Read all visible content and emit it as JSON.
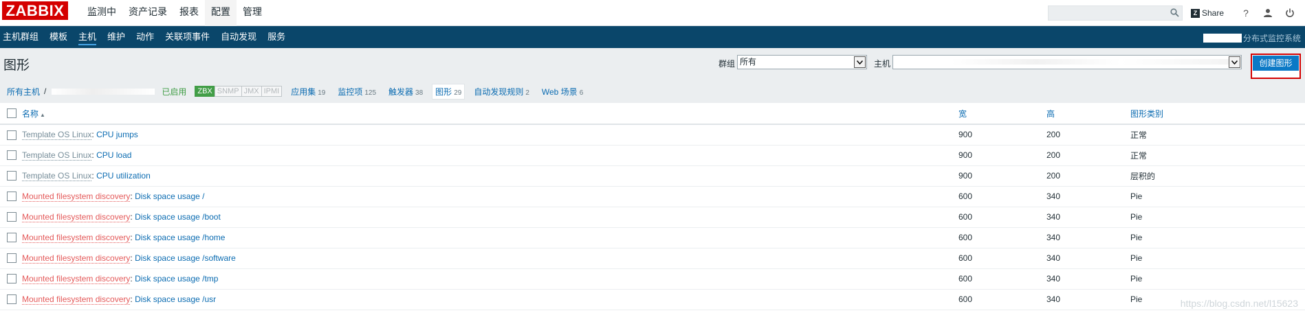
{
  "header": {
    "logo": "ZABBIX",
    "menu": [
      {
        "label": "监测中",
        "active": false
      },
      {
        "label": "资产记录",
        "active": false
      },
      {
        "label": "报表",
        "active": false
      },
      {
        "label": "配置",
        "active": true
      },
      {
        "label": "管理",
        "active": false
      }
    ],
    "search_value": "",
    "share_label": "Share",
    "share_logo_letter": "Z",
    "help_symbol": "?"
  },
  "subnav": {
    "items": [
      {
        "label": "主机群组",
        "active": false
      },
      {
        "label": "模板",
        "active": false
      },
      {
        "label": "主机",
        "active": true
      },
      {
        "label": "维护",
        "active": false
      },
      {
        "label": "动作",
        "active": false
      },
      {
        "label": "关联项事件",
        "active": false
      },
      {
        "label": "自动发现",
        "active": false
      },
      {
        "label": "服务",
        "active": false
      }
    ],
    "system_name": "分布式监控系统"
  },
  "page": {
    "title": "图形",
    "group_label": "群组",
    "group_value": "所有",
    "host_label": "主机",
    "host_value": "",
    "create_button": "创建图形"
  },
  "host_nav": {
    "all_hosts": "所有主机",
    "separator": "/",
    "status": "已启用",
    "availability": [
      {
        "label": "ZBX",
        "on": true
      },
      {
        "label": "SNMP",
        "on": false
      },
      {
        "label": "JMX",
        "on": false
      },
      {
        "label": "IPMI",
        "on": false
      }
    ],
    "links": [
      {
        "label": "应用集",
        "count": "19",
        "current": false
      },
      {
        "label": "监控项",
        "count": "125",
        "current": false
      },
      {
        "label": "触发器",
        "count": "38",
        "current": false
      },
      {
        "label": "图形",
        "count": "29",
        "current": true
      },
      {
        "label": "自动发现规则",
        "count": "2",
        "current": false
      },
      {
        "label": "Web 场景",
        "count": "6",
        "current": false
      }
    ]
  },
  "table": {
    "columns": {
      "name": "名称",
      "width": "宽",
      "height": "高",
      "type": "图形类别"
    },
    "rows": [
      {
        "prefix": "Template OS Linux",
        "prefix_kind": "template",
        "name": "CPU jumps",
        "width": "900",
        "height": "200",
        "type": "正常"
      },
      {
        "prefix": "Template OS Linux",
        "prefix_kind": "template",
        "name": "CPU load",
        "width": "900",
        "height": "200",
        "type": "正常"
      },
      {
        "prefix": "Template OS Linux",
        "prefix_kind": "template",
        "name": "CPU utilization",
        "width": "900",
        "height": "200",
        "type": "层积的"
      },
      {
        "prefix": "Mounted filesystem discovery",
        "prefix_kind": "discovery",
        "name": "Disk space usage /",
        "width": "600",
        "height": "340",
        "type": "Pie"
      },
      {
        "prefix": "Mounted filesystem discovery",
        "prefix_kind": "discovery",
        "name": "Disk space usage /boot",
        "width": "600",
        "height": "340",
        "type": "Pie"
      },
      {
        "prefix": "Mounted filesystem discovery",
        "prefix_kind": "discovery",
        "name": "Disk space usage /home",
        "width": "600",
        "height": "340",
        "type": "Pie"
      },
      {
        "prefix": "Mounted filesystem discovery",
        "prefix_kind": "discovery",
        "name": "Disk space usage /software",
        "width": "600",
        "height": "340",
        "type": "Pie"
      },
      {
        "prefix": "Mounted filesystem discovery",
        "prefix_kind": "discovery",
        "name": "Disk space usage /tmp",
        "width": "600",
        "height": "340",
        "type": "Pie"
      },
      {
        "prefix": "Mounted filesystem discovery",
        "prefix_kind": "discovery",
        "name": "Disk space usage /usr",
        "width": "600",
        "height": "340",
        "type": "Pie"
      }
    ]
  },
  "watermark": "https://blog.csdn.net/l15623",
  "colors": {
    "logo_red": "#d40000",
    "subnav_blue": "#0a466a",
    "link_blue": "#0a6bb1",
    "discovery_orange": "#e45959",
    "enabled_green": "#429e47",
    "button_blue": "#0b79c6"
  },
  "icons": [
    "search-icon",
    "help-icon",
    "user-icon",
    "power-icon",
    "chevron-down-icon",
    "sort-asc-icon"
  ]
}
